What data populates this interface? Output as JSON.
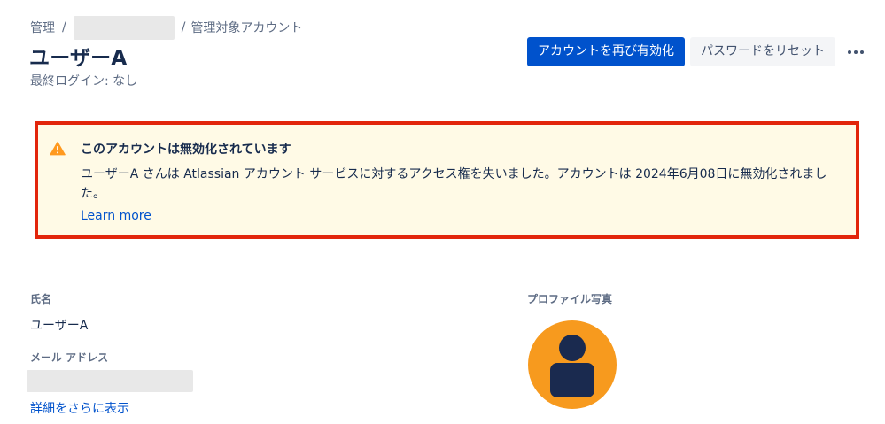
{
  "breadcrumb": {
    "items": [
      "管理",
      "管理対象アカウント"
    ],
    "separator": "/"
  },
  "header": {
    "title": "ユーザーA",
    "last_login": "最終ログイン: なし"
  },
  "actions": {
    "reactivate_label": "アカウントを再び有効化",
    "reset_password_label": "パスワードをリセット",
    "more_icon": "more-horizontal-icon"
  },
  "banner": {
    "icon": "warning-icon",
    "title": "このアカウントは無効化されています",
    "body": "ユーザーA さんは Atlassian アカウント サービスに対するアクセス権を失いました。アカウントは 2024年6月08日に無効化されました。",
    "link": "Learn more"
  },
  "details": {
    "name_label": "氏名",
    "name_value": "ユーザーA",
    "email_label": "メール アドレス",
    "show_more": "詳細をさらに表示",
    "photo_label": "プロファイル写真"
  },
  "colors": {
    "primary": "#0052cc",
    "banner_bg": "#fffae6",
    "highlight_border": "#e2250b",
    "warning": "#ff991f",
    "avatar_bg": "#f79a1e",
    "avatar_figure": "#1a2a4f"
  }
}
